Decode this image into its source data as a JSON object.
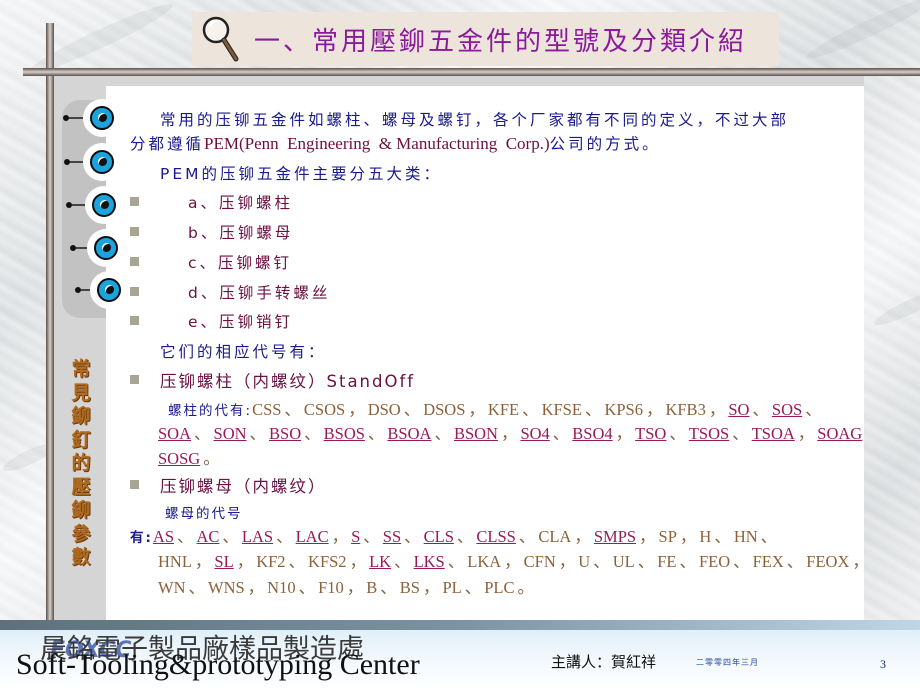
{
  "title": {
    "icon": "magnifier-icon",
    "text": "一、常用壓鉚五金件的型號及分類介紹"
  },
  "sidebar": {
    "vertical_label": [
      "常",
      "見",
      "鉚",
      "釘",
      "的",
      "壓",
      "鉚",
      "參",
      "數"
    ],
    "decor_icon": "eye-bullet-icon"
  },
  "content": {
    "intro_line1": "常用的压铆五金件如螺柱、螺母及螺钉，各个厂家都有不同的定义，不过大部",
    "intro_line2_cn": "分都遵循",
    "intro_line2_en": "PEM(Penn  Engineering  & Manufacturing  Corp.)",
    "intro_line2_tail": "公司的方式。",
    "categories_heading": "PEM的压铆五金件主要分五大类：",
    "categories": [
      "a、压铆螺柱",
      "b、压铆螺母",
      "c、压铆螺钉",
      "d、压铆手转螺丝",
      "e、压铆销钉"
    ],
    "codes_heading": "它们的相应代号有：",
    "standoff": {
      "title": "压铆螺柱（内螺纹）StandOff",
      "codes_label": "螺柱的代有:",
      "lines": [
        [
          {
            "t": "CSS",
            "link": false
          },
          {
            "t": "、",
            "link": false
          },
          {
            "t": "CSOS",
            "link": false
          },
          {
            "t": "，",
            "link": false
          },
          {
            "t": "DSO",
            "link": false
          },
          {
            "t": "、",
            "link": false
          },
          {
            "t": "DSOS",
            "link": false
          },
          {
            "t": "，",
            "link": false
          },
          {
            "t": "KFE",
            "link": false
          },
          {
            "t": "、",
            "link": false
          },
          {
            "t": "KFSE",
            "link": false
          },
          {
            "t": "、",
            "link": false
          },
          {
            "t": "KPS6",
            "link": false
          },
          {
            "t": "，",
            "link": false
          },
          {
            "t": "KFB3",
            "link": false
          },
          {
            "t": "，",
            "link": false
          },
          {
            "t": "SO",
            "link": true
          },
          {
            "t": "、",
            "link": false
          },
          {
            "t": "SOS",
            "link": true
          },
          {
            "t": "、",
            "link": false
          }
        ],
        [
          {
            "t": "SOA",
            "link": true
          },
          {
            "t": "、",
            "link": false
          },
          {
            "t": "SON",
            "link": true
          },
          {
            "t": "、",
            "link": false
          },
          {
            "t": "BSO",
            "link": true
          },
          {
            "t": "、",
            "link": false
          },
          {
            "t": "BSOS",
            "link": true
          },
          {
            "t": "、",
            "link": false
          },
          {
            "t": "BSOA",
            "link": true
          },
          {
            "t": "、",
            "link": false
          },
          {
            "t": "BSON",
            "link": true
          },
          {
            "t": "，",
            "link": false
          },
          {
            "t": "SO4",
            "link": true
          },
          {
            "t": "、",
            "link": false
          },
          {
            "t": "BSO4",
            "link": true
          },
          {
            "t": "，",
            "link": false
          },
          {
            "t": "TSO",
            "link": true
          },
          {
            "t": "、",
            "link": false
          },
          {
            "t": "TSOS",
            "link": true
          },
          {
            "t": "、",
            "link": false
          },
          {
            "t": "TSOA",
            "link": true
          },
          {
            "t": "，",
            "link": false
          },
          {
            "t": "SOAG",
            "link": true
          }
        ],
        [
          {
            "t": "SOSG",
            "link": true
          },
          {
            "t": "。",
            "link": false
          }
        ]
      ]
    },
    "nut": {
      "title": "压铆螺母（内螺纹）",
      "codes_label_1": "螺母的代号",
      "codes_label_2": "有:",
      "lines": [
        [
          {
            "t": "AS",
            "link": true
          },
          {
            "t": "、",
            "link": false
          },
          {
            "t": "AC",
            "link": true
          },
          {
            "t": "、",
            "link": false
          },
          {
            "t": "LAS",
            "link": true
          },
          {
            "t": "、",
            "link": false
          },
          {
            "t": "LAC",
            "link": true
          },
          {
            "t": "，",
            "link": false
          },
          {
            "t": "S",
            "link": true
          },
          {
            "t": "、",
            "link": false
          },
          {
            "t": "SS",
            "link": true
          },
          {
            "t": "、",
            "link": false
          },
          {
            "t": "CLS",
            "link": true
          },
          {
            "t": "、",
            "link": false
          },
          {
            "t": "CLSS",
            "link": true
          },
          {
            "t": "、",
            "link": false
          },
          {
            "t": "CLA",
            "link": false
          },
          {
            "t": "，",
            "link": false
          },
          {
            "t": "SMPS",
            "link": true
          },
          {
            "t": "，",
            "link": false
          },
          {
            "t": "SP",
            "link": false
          },
          {
            "t": "，",
            "link": false
          },
          {
            "t": "H",
            "link": false
          },
          {
            "t": "、",
            "link": false
          },
          {
            "t": "HN",
            "link": false
          },
          {
            "t": "、",
            "link": false
          }
        ],
        [
          {
            "t": "HNL",
            "link": false
          },
          {
            "t": "，",
            "link": false
          },
          {
            "t": "SL",
            "link": true
          },
          {
            "t": "，",
            "link": false
          },
          {
            "t": "KF2",
            "link": false
          },
          {
            "t": "、",
            "link": false
          },
          {
            "t": "KFS2",
            "link": false
          },
          {
            "t": "，",
            "link": false
          },
          {
            "t": "LK",
            "link": true
          },
          {
            "t": "、",
            "link": false
          },
          {
            "t": "LKS",
            "link": true
          },
          {
            "t": "、",
            "link": false
          },
          {
            "t": "LKA",
            "link": false
          },
          {
            "t": "，",
            "link": false
          },
          {
            "t": "CFN",
            "link": false
          },
          {
            "t": "，",
            "link": false
          },
          {
            "t": "U",
            "link": false
          },
          {
            "t": "、",
            "link": false
          },
          {
            "t": "UL",
            "link": false
          },
          {
            "t": "、",
            "link": false
          },
          {
            "t": "FE",
            "link": false
          },
          {
            "t": "、",
            "link": false
          },
          {
            "t": "FEO",
            "link": false
          },
          {
            "t": "、",
            "link": false
          },
          {
            "t": "FEX",
            "link": false
          },
          {
            "t": "、",
            "link": false
          },
          {
            "t": "FEOX",
            "link": false
          },
          {
            "t": "，",
            "link": false
          }
        ],
        [
          {
            "t": "WN",
            "link": false
          },
          {
            "t": "、",
            "link": false
          },
          {
            "t": "WNS",
            "link": false
          },
          {
            "t": "，",
            "link": false
          },
          {
            "t": "N10",
            "link": false
          },
          {
            "t": "、",
            "link": false
          },
          {
            "t": "F10",
            "link": false
          },
          {
            "t": "，",
            "link": false
          },
          {
            "t": "B",
            "link": false
          },
          {
            "t": "、",
            "link": false
          },
          {
            "t": "BS",
            "link": false
          },
          {
            "t": "，",
            "link": false
          },
          {
            "t": "PL",
            "link": false
          },
          {
            "t": "、",
            "link": false
          },
          {
            "t": "PLC",
            "link": false
          },
          {
            "t": "。",
            "link": false
          }
        ]
      ]
    }
  },
  "footer": {
    "logo": "FOXCC",
    "org_cn": "晨銘電子製品廠樣品製造處",
    "org_en": "Soft-Tooling&prototyping Center",
    "speaker": "主講人：賀紅祥",
    "date": "二零零四年三月",
    "page_number": "3"
  },
  "colors": {
    "title_purple": "#8b1a9a",
    "body_blue": "#1a1a8c",
    "maroon": "#6b1040",
    "code_brown": "#8b6239",
    "link_magenta": "#9a1a58",
    "bullet_gray": "#a8a592"
  }
}
